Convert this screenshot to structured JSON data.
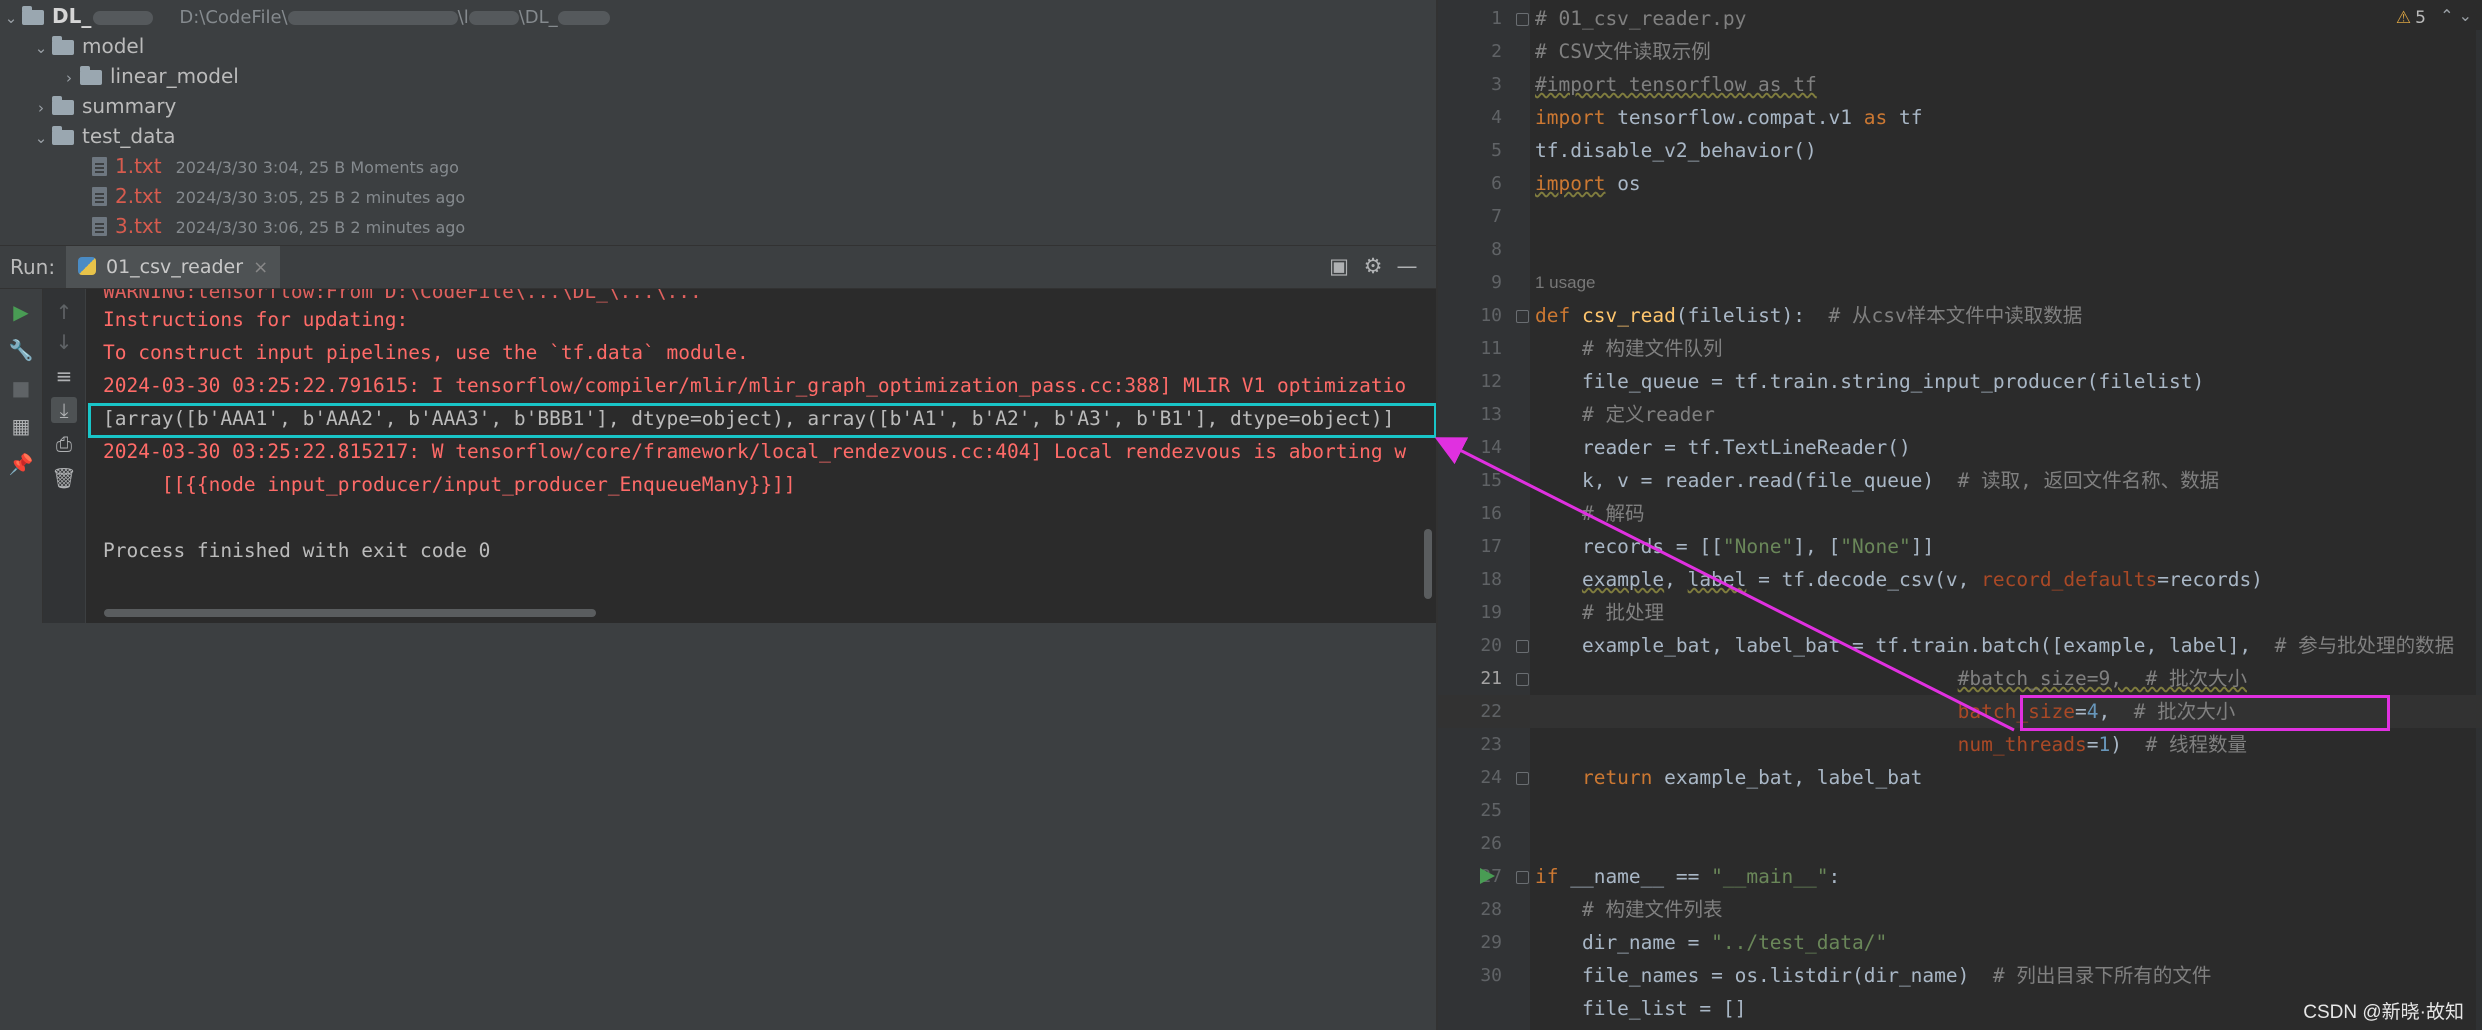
{
  "project": {
    "root_name": "DL_",
    "root_path_prefix": "D:\\CodeFile\\",
    "root_path_mid": "\\l",
    "root_path_end": "\\DL_",
    "items": [
      {
        "type": "folder",
        "label": "model",
        "expanded": true
      },
      {
        "type": "folder",
        "label": "linear_model",
        "expanded": false
      },
      {
        "type": "folder",
        "label": "summary",
        "expanded": false
      },
      {
        "type": "folder",
        "label": "test_data",
        "expanded": true
      }
    ],
    "files": [
      {
        "name": "1.txt",
        "meta": "2024/3/30 3:04, 25 B Moments ago"
      },
      {
        "name": "2.txt",
        "meta": "2024/3/30 3:05, 25 B 2 minutes ago"
      },
      {
        "name": "3.txt",
        "meta": "2024/3/30 3:06, 25 B 2 minutes ago"
      }
    ]
  },
  "run": {
    "label": "Run:",
    "tab_label": "01_csv_reader",
    "console_lines": [
      {
        "text": "Instructions for updating:",
        "color": "red"
      },
      {
        "text": "To construct input pipelines, use the `tf.data` module.",
        "color": "red"
      },
      {
        "text": "2024-03-30 03:25:22.791615: I tensorflow/compiler/mlir/mlir_graph_optimization_pass.cc:388] MLIR V1 optimizatio",
        "color": "red"
      },
      {
        "text": "[array([b'AAA1', b'AAA2', b'AAA3', b'BBB1'], dtype=object), array([b'A1', b'A2', b'A3', b'B1'], dtype=object)]",
        "color": "white"
      },
      {
        "text": "2024-03-30 03:25:22.815217: W tensorflow/core/framework/local_rendezvous.cc:404] Local rendezvous is aborting w",
        "color": "red"
      },
      {
        "text": "     [[{{node input_producer/input_producer_EnqueueMany}}]]",
        "color": "red"
      },
      {
        "text": "",
        "color": "white"
      },
      {
        "text": "Process finished with exit code 0",
        "color": "white"
      }
    ]
  },
  "editor": {
    "warning_count": "5",
    "usage_hint": "1 usage",
    "watermark": "CSDN @新晓·故知",
    "line_numbers": [
      "1",
      "2",
      "3",
      "4",
      "5",
      "6",
      "7",
      "8",
      "9",
      "10",
      "11",
      "12",
      "13",
      "14",
      "15",
      "16",
      "17",
      "18",
      "19",
      "20",
      "21",
      "22",
      "23",
      "24",
      "25",
      "26",
      "27",
      "28",
      "29",
      "30"
    ],
    "code": {
      "l1": "# 01_csv_reader.py",
      "l2": "# CSV文件读取示例",
      "l3": "#import tensorflow as tf",
      "l4_kw": "import",
      "l4_mod": " tensorflow.compat.v1 ",
      "l4_as": "as",
      "l4_alias": " tf",
      "l5": "tf.disable_v2_behavior()",
      "l6_kw": "import",
      "l6_mod": " os",
      "l9_def": "def ",
      "l9_fn": "csv_read",
      "l9_args": "(filelist):  ",
      "l9_cmt": "# 从csv样本文件中读取数据",
      "l10": "    # 构建文件队列",
      "l11": "    file_queue = tf.train.string_input_producer(filelist)",
      "l12": "    # 定义reader",
      "l13": "    reader = tf.TextLineReader()",
      "l14_a": "    k, v = reader.read(file_queue)  ",
      "l14_cmt": "# 读取, 返回文件名称、数据",
      "l15": "    # 解码",
      "l16_a": "    records = [[",
      "l16_s1": "\"None\"",
      "l16_b": "], [",
      "l16_s2": "\"None\"",
      "l16_c": "]]",
      "l17_a": "    ",
      "l17_ex": "example",
      "l17_b": ", ",
      "l17_lb": "label",
      "l17_c": " = tf.decode_csv(v, ",
      "l17_p": "record_defaults",
      "l17_d": "=records)",
      "l18": "    # 批处理",
      "l19_a": "    example_bat, label_bat = tf.train.batch([example, label],  ",
      "l19_cmt": "# 参与批处理的数据",
      "l20_pad": "                                    ",
      "l20_cmt": "#batch_size=9,  ",
      "l20_cmt2": "# 批次大小",
      "l21_pad": "                                    ",
      "l21_p": "batch_size",
      "l21_eq": "=",
      "l21_n": "4",
      "l21_c": ",  ",
      "l21_cmt": "# 批次大小",
      "l22_pad": "                                    ",
      "l22_p": "num_threads",
      "l22_eq": "=",
      "l22_n": "1",
      "l22_c": ")  ",
      "l22_cmt": "# 线程数量",
      "l23_kw": "    return",
      "l23_b": " example_bat, label_bat",
      "l26_kw": "if",
      "l26_a": " __name__ == ",
      "l26_s": "\"__main__\"",
      "l26_b": ":",
      "l27": "    # 构建文件列表",
      "l28_a": "    dir_name = ",
      "l28_s": "\"../test_data/\"",
      "l29_a": "    file_names = os.listdir(dir_name)  ",
      "l29_cmt": "# 列出目录下所有的文件",
      "l30": "    file_list = []"
    }
  },
  "colors": {
    "highlight_console": "#19c5c8",
    "highlight_code": "#e030e0"
  }
}
